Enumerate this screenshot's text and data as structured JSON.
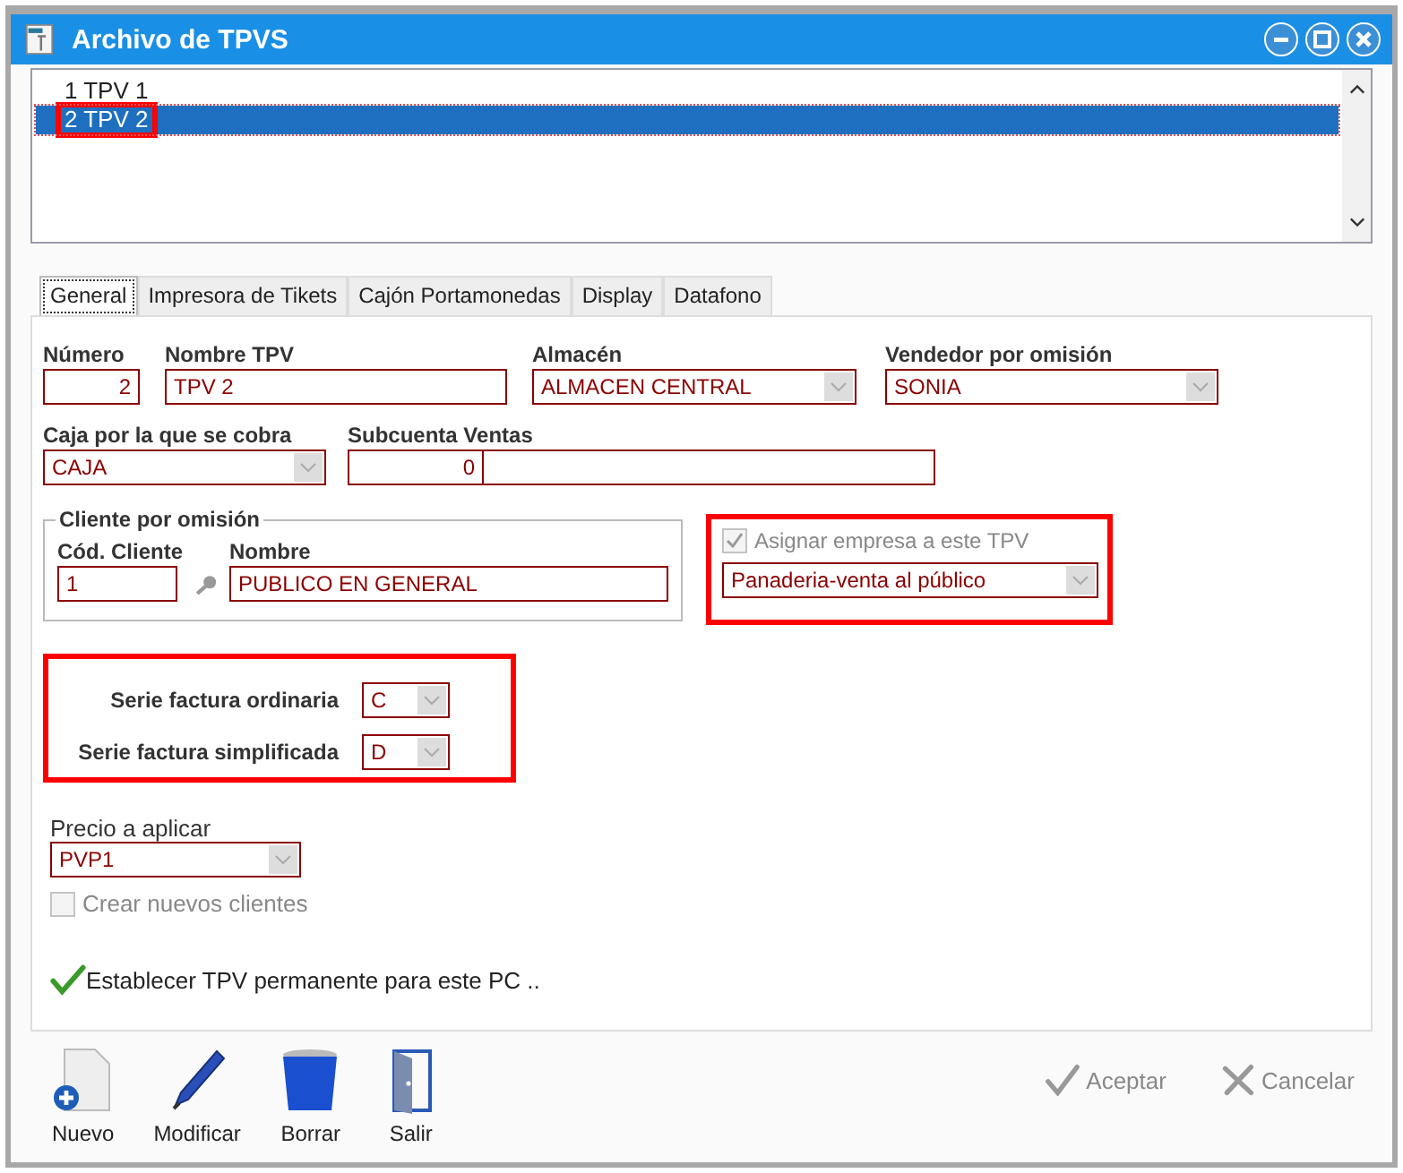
{
  "window": {
    "title": "Archivo de TPVS"
  },
  "list": {
    "items": [
      {
        "label": "1 TPV 1",
        "selected": false,
        "highlighted": false
      },
      {
        "label": "2 TPV 2",
        "selected": true,
        "highlighted": true
      }
    ]
  },
  "tabs": [
    {
      "label": "General",
      "selected": true
    },
    {
      "label": "Impresora de Tikets",
      "selected": false
    },
    {
      "label": "Cajón Portamonedas",
      "selected": false
    },
    {
      "label": "Display",
      "selected": false
    },
    {
      "label": "Datafono",
      "selected": false
    }
  ],
  "general": {
    "row1": [
      {
        "label": "Número",
        "value": "2",
        "kind": "number"
      },
      {
        "label": "Nombre TPV",
        "value": "TPV 2",
        "kind": "text"
      },
      {
        "label": "Almacén",
        "value": "ALMACEN CENTRAL",
        "kind": "combo"
      },
      {
        "label": "Vendedor por omisión",
        "value": "SONIA",
        "kind": "combo"
      }
    ],
    "caja": {
      "label": "Caja por la que se cobra",
      "value": "CAJA"
    },
    "subcuenta": {
      "label": "Subcuenta Ventas",
      "value": "0"
    },
    "cliente": {
      "title": "Cliente por omisión",
      "code_label": "Cód. Cliente",
      "code": "1",
      "name_label": "Nombre",
      "name": "PUBLICO EN GENERAL"
    },
    "empresa": {
      "label": "Asignar empresa a este TPV",
      "checked": true,
      "disabled": true,
      "value": "Panaderia-venta al público"
    },
    "series": [
      {
        "label": "Serie factura ordinaria",
        "value": "C"
      },
      {
        "label": "Serie factura simplificada",
        "value": "D"
      }
    ],
    "precio": {
      "label": "Precio a aplicar",
      "value": "PVP1"
    },
    "crear_clientes": {
      "label": "Crear nuevos clientes",
      "checked": false,
      "disabled": true
    },
    "establecer": {
      "label": "Establecer TPV permanente para este PC .."
    }
  },
  "toolbar": [
    {
      "label": "Nuevo",
      "kind": "new"
    },
    {
      "label": "Modificar",
      "kind": "edit"
    },
    {
      "label": "Borrar",
      "kind": "delete"
    },
    {
      "label": "Salir",
      "kind": "exit"
    }
  ],
  "actions": [
    {
      "label": "Aceptar",
      "kind": "ok",
      "disabled": true
    },
    {
      "label": "Cancelar",
      "kind": "cancel",
      "disabled": true
    }
  ]
}
